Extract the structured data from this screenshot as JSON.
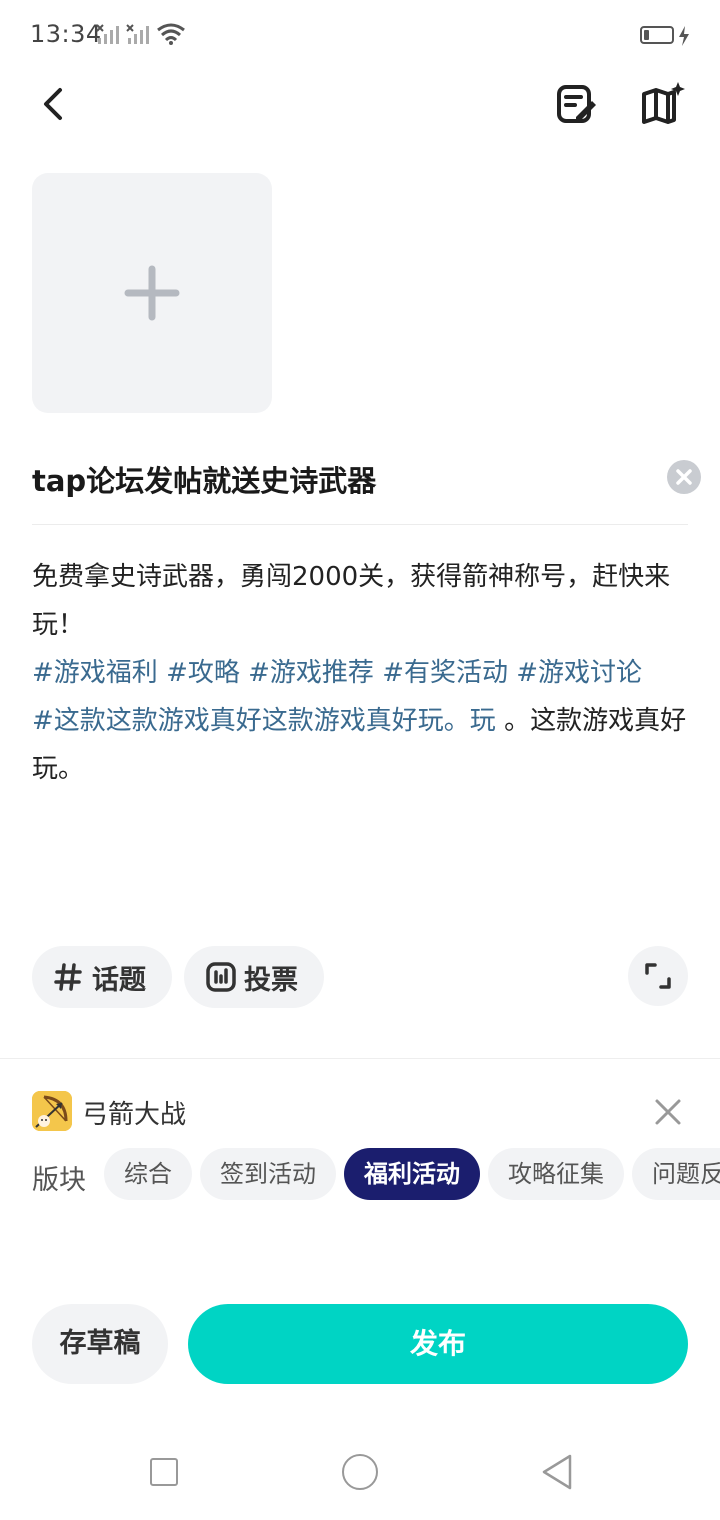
{
  "status_bar": {
    "time": "13:34",
    "icons": [
      "signal-1-icon",
      "signal-2-icon",
      "wifi-icon",
      "battery-icon",
      "charging-icon"
    ]
  },
  "top_bar": {
    "icons": [
      "back-arrow-icon",
      "edit-note-icon",
      "guide-book-icon"
    ]
  },
  "editor": {
    "image_picker_icon": "plus-icon",
    "title": "tap论坛发帖就送史诗武器",
    "body_text": "免费拿史诗武器，勇闯2000关，获得箭神称号，赶快来玩！",
    "tags": [
      "#游戏福利",
      "#攻略",
      "#游戏推荐",
      "#有奖活动",
      "#游戏讨论",
      "#这款这款游戏真好这款游戏真好玩。玩"
    ],
    "body_tail": "。这款游戏真好玩。"
  },
  "tools": {
    "topic_label": "话题",
    "vote_label": "投票"
  },
  "game": {
    "name": "弓箭大战"
  },
  "board": {
    "label": "版块",
    "tabs": [
      "综合",
      "签到活动",
      "福利活动",
      "攻略征集",
      "问题反馈"
    ],
    "selected": "福利活动"
  },
  "actions": {
    "draft_label": "存草稿",
    "publish_label": "发布"
  },
  "colors": {
    "accent": "#00d4c4",
    "tab_selected": "#1b1e6e",
    "hashtag": "#3a6a8f"
  }
}
